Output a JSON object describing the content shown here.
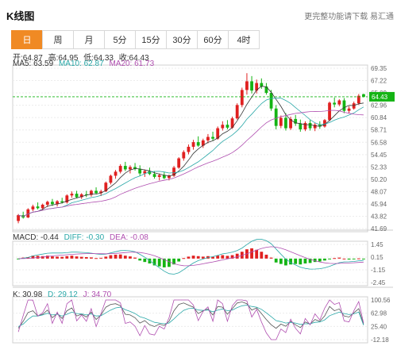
{
  "header": {
    "title": "K线图",
    "promo": "更完整功能请下载 易汇通"
  },
  "tabs": [
    "日",
    "周",
    "月",
    "5分",
    "15分",
    "30分",
    "60分",
    "4时"
  ],
  "active_tab": 0,
  "ohlc": {
    "open": "开:64.87",
    "high": "高:64.95",
    "low": "低:64.33",
    "close": "收:64.43"
  },
  "ma": {
    "ma5": "MA5: 63.59",
    "ma10": "MA10: 62.87",
    "ma20": "MA20: 61.73"
  },
  "macd": {
    "macd": "MACD: -0.44",
    "diff": "DIFF: -0.30",
    "dea": "DEA: -0.08"
  },
  "kdj": {
    "k": "K: 30.98",
    "d": "D: 29.12",
    "j": "J: 34.70"
  },
  "price_axis": [
    "69.35",
    "67.22",
    "65.09",
    "62.96",
    "60.84",
    "58.71",
    "56.58",
    "54.45",
    "52.33",
    "50.20",
    "48.07",
    "45.94",
    "43.82",
    "41.69"
  ],
  "current_price": "64.43",
  "macd_axis": [
    "1.45",
    "0.15",
    "-1.15",
    "-2.45"
  ],
  "kdj_axis": [
    "100.56",
    "62.98",
    "25.40",
    "-12.18"
  ],
  "colors": {
    "up": "#e02020",
    "down": "#14b414",
    "ma5": "#333333",
    "ma10": "#2aa8a8",
    "ma20": "#b04fb0",
    "accent": "#f08a24",
    "price_tag": "#14b414"
  },
  "chart_data": {
    "type": "candlestick",
    "price_range": [
      41.69,
      69.35
    ],
    "candles": [
      [
        43.0,
        44.2,
        42.6,
        44.0
      ],
      [
        44.0,
        44.6,
        43.4,
        43.6
      ],
      [
        43.6,
        45.2,
        43.5,
        45.0
      ],
      [
        45.0,
        45.8,
        44.7,
        45.5
      ],
      [
        45.5,
        46.2,
        45.0,
        45.2
      ],
      [
        45.2,
        46.0,
        44.8,
        45.8
      ],
      [
        45.8,
        46.5,
        45.4,
        46.3
      ],
      [
        46.3,
        46.8,
        45.6,
        45.9
      ],
      [
        45.9,
        46.6,
        45.5,
        46.4
      ],
      [
        46.4,
        47.0,
        46.0,
        46.2
      ],
      [
        46.2,
        47.6,
        46.0,
        47.4
      ],
      [
        47.4,
        48.1,
        47.0,
        47.7
      ],
      [
        47.7,
        48.2,
        46.9,
        47.1
      ],
      [
        47.1,
        47.8,
        46.8,
        47.6
      ],
      [
        47.6,
        48.2,
        47.1,
        47.5
      ],
      [
        47.5,
        48.4,
        47.2,
        48.2
      ],
      [
        48.2,
        48.8,
        47.6,
        47.8
      ],
      [
        47.8,
        48.4,
        47.3,
        48.1
      ],
      [
        48.1,
        49.8,
        48.0,
        49.6
      ],
      [
        49.6,
        51.0,
        49.3,
        50.8
      ],
      [
        50.8,
        51.8,
        50.3,
        51.5
      ],
      [
        51.5,
        52.8,
        51.2,
        52.5
      ],
      [
        52.5,
        53.2,
        51.6,
        51.9
      ],
      [
        51.9,
        52.6,
        51.2,
        52.3
      ],
      [
        52.3,
        53.0,
        51.7,
        52.0
      ],
      [
        52.0,
        52.6,
        50.8,
        51.2
      ],
      [
        51.2,
        51.9,
        50.6,
        51.6
      ],
      [
        51.6,
        52.2,
        50.9,
        51.1
      ],
      [
        51.1,
        51.6,
        50.3,
        50.6
      ],
      [
        50.6,
        51.2,
        50.0,
        50.9
      ],
      [
        50.9,
        51.4,
        50.2,
        50.4
      ],
      [
        50.4,
        51.0,
        50.0,
        50.8
      ],
      [
        50.8,
        52.5,
        50.6,
        52.2
      ],
      [
        52.2,
        54.0,
        52.0,
        53.8
      ],
      [
        53.8,
        55.2,
        53.4,
        54.9
      ],
      [
        54.9,
        56.2,
        54.5,
        55.8
      ],
      [
        55.8,
        57.0,
        55.3,
        56.6
      ],
      [
        56.6,
        57.6,
        55.8,
        56.0
      ],
      [
        56.0,
        57.2,
        55.6,
        56.9
      ],
      [
        56.9,
        58.0,
        56.4,
        57.5
      ],
      [
        57.5,
        58.4,
        56.9,
        57.2
      ],
      [
        57.2,
        59.3,
        57.0,
        59.0
      ],
      [
        59.0,
        60.2,
        58.6,
        59.6
      ],
      [
        59.6,
        60.4,
        58.8,
        59.1
      ],
      [
        59.1,
        61.0,
        58.9,
        60.7
      ],
      [
        60.7,
        63.3,
        60.5,
        63.0
      ],
      [
        63.0,
        66.0,
        62.6,
        65.6
      ],
      [
        65.6,
        68.5,
        64.8,
        67.1
      ],
      [
        67.1,
        68.0,
        65.0,
        65.5
      ],
      [
        65.5,
        67.4,
        65.0,
        66.8
      ],
      [
        66.8,
        67.6,
        65.8,
        66.2
      ],
      [
        66.2,
        66.8,
        64.8,
        65.1
      ],
      [
        65.1,
        65.6,
        62.0,
        62.4
      ],
      [
        62.4,
        63.0,
        58.8,
        59.4
      ],
      [
        59.4,
        61.2,
        59.0,
        60.8
      ],
      [
        60.8,
        61.6,
        58.6,
        59.0
      ],
      [
        59.0,
        61.0,
        58.7,
        60.6
      ],
      [
        60.6,
        61.3,
        59.4,
        59.8
      ],
      [
        59.8,
        60.5,
        58.4,
        58.8
      ],
      [
        58.8,
        60.2,
        58.5,
        59.9
      ],
      [
        59.9,
        60.4,
        58.6,
        59.0
      ],
      [
        59.0,
        59.9,
        58.5,
        59.6
      ],
      [
        59.6,
        60.2,
        58.9,
        59.3
      ],
      [
        59.3,
        60.6,
        59.1,
        60.4
      ],
      [
        60.4,
        63.6,
        60.2,
        63.4
      ],
      [
        63.4,
        64.3,
        62.6,
        63.1
      ],
      [
        63.1,
        64.0,
        62.8,
        63.8
      ],
      [
        63.8,
        64.2,
        61.6,
        62.0
      ],
      [
        62.0,
        62.8,
        61.6,
        62.4
      ],
      [
        62.4,
        63.6,
        62.2,
        63.3
      ],
      [
        63.3,
        64.9,
        63.0,
        64.6
      ],
      [
        64.87,
        64.95,
        64.33,
        64.43
      ]
    ],
    "macd_range": [
      -2.45,
      1.45
    ],
    "macd_hist": [
      -0.05,
      0.1,
      0.15,
      0.3,
      0.28,
      0.25,
      0.3,
      0.22,
      0.2,
      0.18,
      0.25,
      0.3,
      0.22,
      0.18,
      0.15,
      0.12,
      0.05,
      0.08,
      0.2,
      0.35,
      0.4,
      0.42,
      0.3,
      0.22,
      0.1,
      -0.2,
      -0.35,
      -0.5,
      -0.7,
      -0.8,
      -0.9,
      -0.85,
      -0.6,
      -0.3,
      0.05,
      0.2,
      0.3,
      0.25,
      0.2,
      0.25,
      0.18,
      0.3,
      0.35,
      0.28,
      0.35,
      0.5,
      0.7,
      0.95,
      1.05,
      0.9,
      0.7,
      0.4,
      0.1,
      -0.4,
      -0.55,
      -0.7,
      -0.6,
      -0.55,
      -0.6,
      -0.5,
      -0.45,
      -0.35,
      -0.3,
      -0.2,
      -0.05,
      0.05,
      0.1,
      0.0,
      -0.1,
      -0.05,
      0.02,
      -0.02
    ],
    "kdj_range": [
      -12.18,
      100.56
    ],
    "kdj_k": [
      20,
      40,
      65,
      70,
      55,
      60,
      72,
      50,
      62,
      48,
      70,
      78,
      55,
      60,
      52,
      66,
      45,
      58,
      80,
      88,
      90,
      84,
      60,
      58,
      50,
      35,
      42,
      30,
      25,
      32,
      28,
      40,
      70,
      88,
      92,
      86,
      80,
      62,
      70,
      75,
      58,
      82,
      80,
      60,
      76,
      92,
      95,
      90,
      72,
      78,
      62,
      45,
      30,
      20,
      32,
      26,
      40,
      30,
      22,
      38,
      32,
      45,
      40,
      55,
      82,
      70,
      75,
      55,
      52,
      64,
      76,
      31
    ],
    "kdj_d": [
      25,
      32,
      45,
      55,
      55,
      58,
      63,
      58,
      60,
      55,
      60,
      66,
      62,
      61,
      58,
      61,
      55,
      56,
      64,
      72,
      78,
      80,
      73,
      68,
      62,
      53,
      49,
      43,
      37,
      35,
      33,
      35,
      47,
      60,
      71,
      76,
      77,
      72,
      71,
      72,
      67,
      72,
      75,
      70,
      72,
      79,
      84,
      86,
      82,
      80,
      74,
      64,
      53,
      42,
      39,
      35,
      37,
      35,
      31,
      33,
      33,
      37,
      38,
      44,
      56,
      61,
      66,
      62,
      59,
      61,
      66,
      29
    ],
    "kdj_j": [
      10,
      56,
      105,
      100,
      55,
      64,
      90,
      34,
      66,
      34,
      90,
      102,
      41,
      58,
      40,
      76,
      25,
      62,
      112,
      120,
      114,
      92,
      34,
      38,
      26,
      -1,
      28,
      4,
      1,
      26,
      18,
      50,
      116,
      144,
      134,
      106,
      86,
      42,
      68,
      81,
      40,
      102,
      90,
      40,
      84,
      118,
      117,
      98,
      52,
      74,
      38,
      7,
      -16,
      -24,
      18,
      8,
      46,
      20,
      4,
      48,
      30,
      61,
      44,
      77,
      134,
      88,
      93,
      41,
      38,
      70,
      96,
      34.7
    ]
  }
}
